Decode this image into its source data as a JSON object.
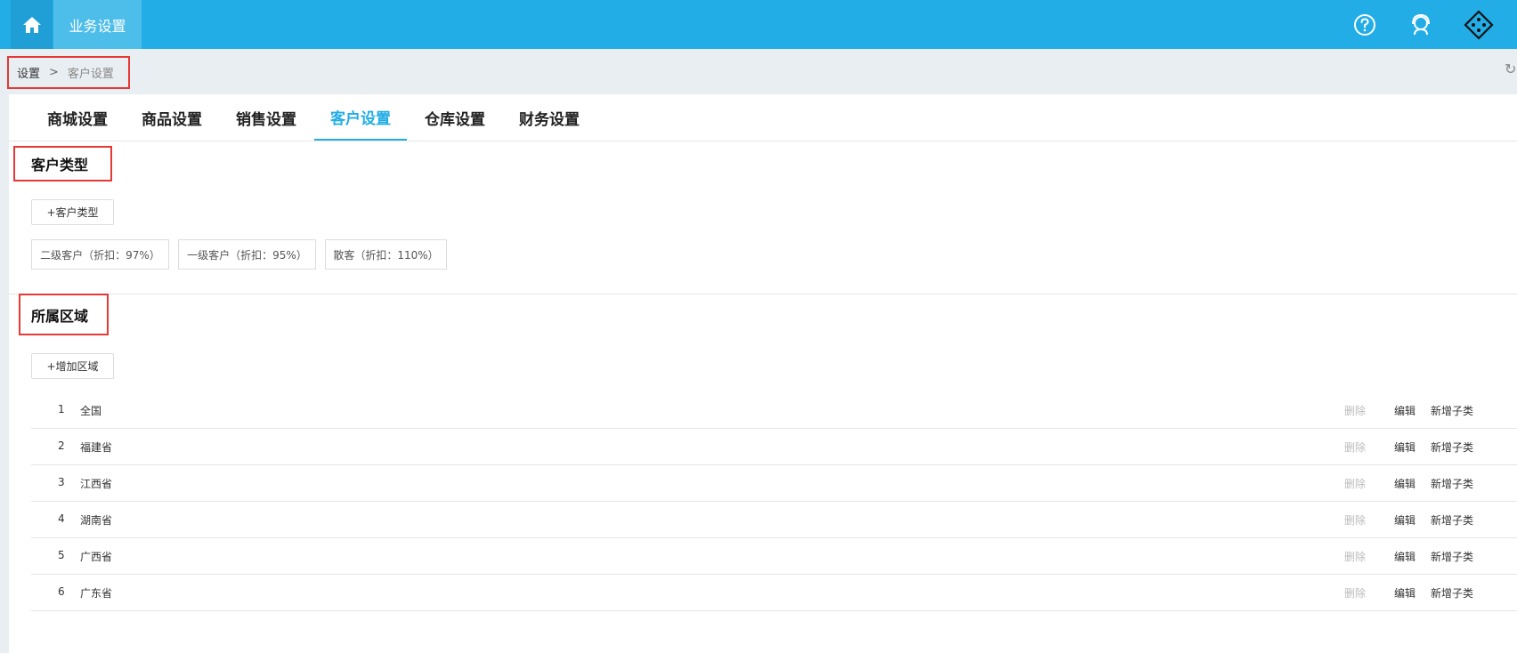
{
  "topbar": {
    "title": "业务设置"
  },
  "breadcrumb": {
    "root": "设置",
    "separator": ">",
    "current": "客户设置"
  },
  "tabs": [
    {
      "label": "商城设置"
    },
    {
      "label": "商品设置"
    },
    {
      "label": "销售设置"
    },
    {
      "label": "客户设置",
      "active": true
    },
    {
      "label": "仓库设置"
    },
    {
      "label": "财务设置"
    }
  ],
  "customer_type": {
    "title": "客户类型",
    "add_label": "+客户类型",
    "tags": [
      {
        "label": "二级客户（折扣：97%）"
      },
      {
        "label": "一级客户（折扣：95%）"
      },
      {
        "label": "散客（折扣：110%）"
      }
    ]
  },
  "region": {
    "title": "所属区域",
    "add_label": "+增加区域",
    "rows": [
      {
        "num": "1",
        "name": "全国",
        "delete": "删除",
        "edit": "编辑",
        "add_child": "新增子类"
      },
      {
        "num": "2",
        "name": "福建省",
        "delete": "删除",
        "edit": "编辑",
        "add_child": "新增子类"
      },
      {
        "num": "3",
        "name": "江西省",
        "delete": "删除",
        "edit": "编辑",
        "add_child": "新增子类"
      },
      {
        "num": "4",
        "name": "湖南省",
        "delete": "删除",
        "edit": "编辑",
        "add_child": "新增子类"
      },
      {
        "num": "5",
        "name": "广西省",
        "delete": "删除",
        "edit": "编辑",
        "add_child": "新增子类"
      },
      {
        "num": "6",
        "name": "广东省",
        "delete": "删除",
        "edit": "编辑",
        "add_child": "新增子类"
      }
    ]
  },
  "icons": {
    "home": "home-icon",
    "help": "help-icon",
    "support": "headset-icon",
    "menu": "diamond-menu-icon",
    "refresh": "refresh-icon"
  },
  "colors": {
    "brand": "#22ade6",
    "highlight": "#e53935",
    "disabled": "#bbbbbb"
  }
}
